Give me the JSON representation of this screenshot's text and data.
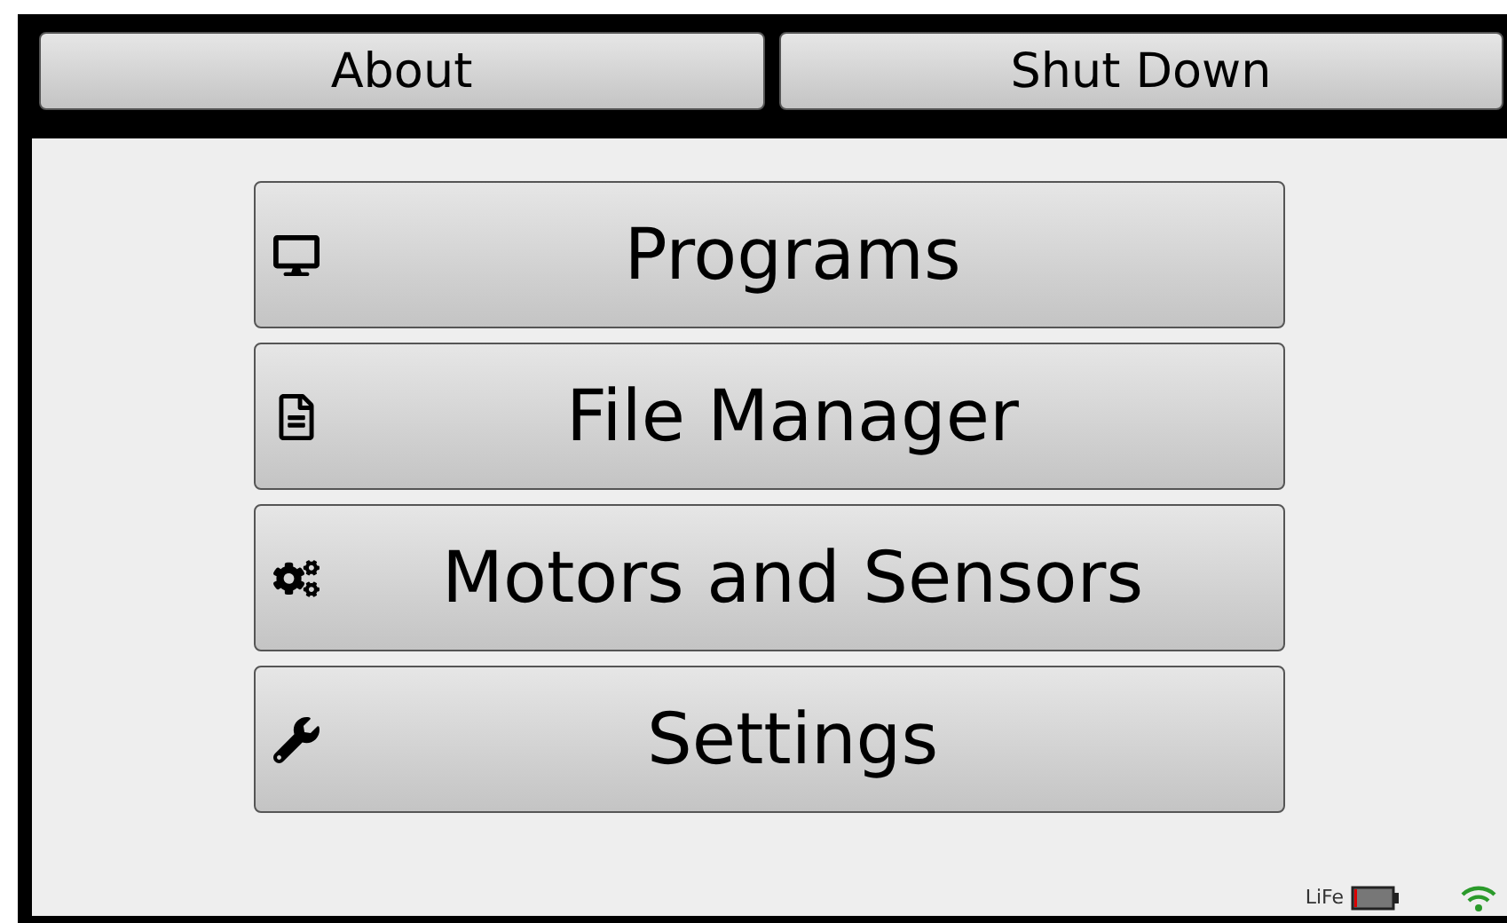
{
  "top_buttons": [
    "About",
    "Shut Down"
  ],
  "menu_items": [
    "Programs",
    "File Manager",
    "Motors and Sensors",
    "Settings"
  ],
  "status_bar": {
    "battery_label": "LiFe"
  }
}
